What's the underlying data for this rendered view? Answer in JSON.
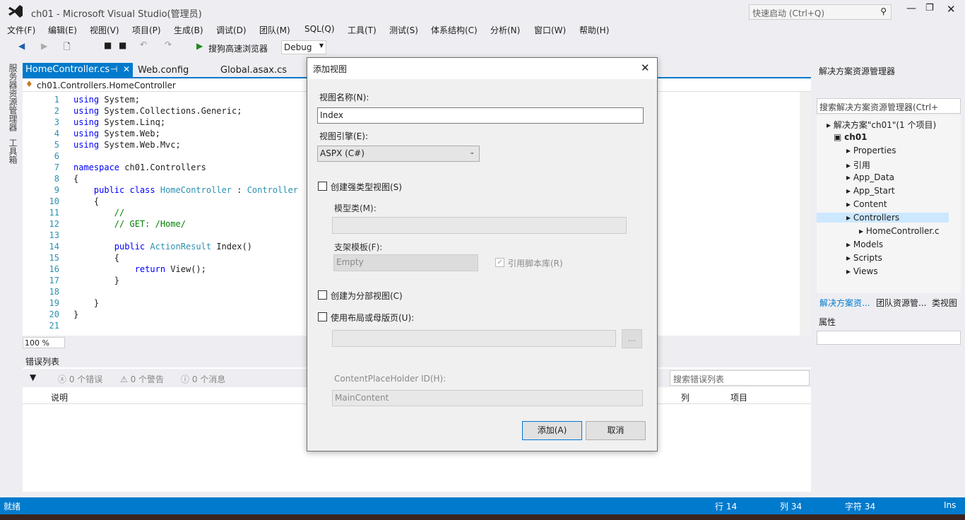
{
  "window": {
    "title": "ch01 - Microsoft Visual Studio(管理员)",
    "quick_launch": "快速启动 (Ctrl+Q)"
  },
  "menu": [
    "文件(F)",
    "编辑(E)",
    "视图(V)",
    "项目(P)",
    "生成(B)",
    "调试(D)",
    "团队(M)",
    "SQL(Q)",
    "工具(T)",
    "测试(S)",
    "体系结构(C)",
    "分析(N)",
    "窗口(W)",
    "帮助(H)"
  ],
  "toolbar": {
    "run_label": "搜狗高速浏览器",
    "config": "Debug"
  },
  "side_tabs": [
    "服务器资源管理器",
    "工具箱"
  ],
  "tabs": [
    "HomeController.cs",
    "Web.config",
    "Global.asax.cs"
  ],
  "nav_bar": "ch01.Controllers.HomeController",
  "code_lines": [
    [
      [
        "kw",
        "using"
      ],
      [
        "",
        "System;"
      ]
    ],
    [
      [
        "kw",
        "using"
      ],
      [
        "",
        "System.Collections.Generic;"
      ]
    ],
    [
      [
        "kw",
        "using"
      ],
      [
        "",
        "System.Linq;"
      ]
    ],
    [
      [
        "kw",
        "using"
      ],
      [
        "",
        "System.Web;"
      ]
    ],
    [
      [
        "kw",
        "using"
      ],
      [
        "",
        "System.Web.Mvc;"
      ]
    ],
    [],
    [
      [
        "kw",
        "namespace"
      ],
      [
        "",
        "ch01.Controllers"
      ]
    ],
    [
      [
        "",
        "{"
      ]
    ],
    [
      [
        "",
        "    "
      ],
      [
        "kw",
        "public class"
      ],
      [
        "ty",
        "HomeController"
      ],
      [
        "",
        ":"
      ],
      [
        "ty",
        "Controller"
      ]
    ],
    [
      [
        "",
        "    {"
      ]
    ],
    [
      [
        "cm",
        "        //"
      ]
    ],
    [
      [
        "cm",
        "        // GET: /Home/"
      ]
    ],
    [],
    [
      [
        "",
        "        "
      ],
      [
        "kw",
        "public"
      ],
      [
        "ty",
        "ActionResult"
      ],
      [
        "",
        "Index()"
      ]
    ],
    [
      [
        "",
        "        {"
      ]
    ],
    [
      [
        "",
        "            "
      ],
      [
        "kw",
        "return"
      ],
      [
        "",
        "View();"
      ]
    ],
    [
      [
        "",
        "        }"
      ]
    ],
    [],
    [
      [
        "",
        "    }"
      ]
    ],
    [
      [
        "",
        "}"
      ]
    ],
    []
  ],
  "zoom": "100 %",
  "error_list": {
    "title": "错误列表",
    "errors": "0 个错误",
    "warnings": "0 个警告",
    "messages": "0 个消息",
    "search_placeholder": "搜索错误列表",
    "columns": [
      "说明",
      "列",
      "项目"
    ]
  },
  "solution_explorer": {
    "title": "解决方案资源管理器",
    "search_placeholder": "搜索解决方案资源管理器(Ctrl+",
    "items": [
      "解决方案\"ch01\"(1 个项目)",
      "ch01",
      "Properties",
      "引用",
      "App_Data",
      "App_Start",
      "Content",
      "Controllers",
      "HomeController.c",
      "Models",
      "Scripts",
      "Views"
    ],
    "bottom_tabs": [
      "解决方案资...",
      "团队资源管...",
      "类视图"
    ]
  },
  "properties": {
    "title": "属性"
  },
  "dialog": {
    "title": "添加视图",
    "name_label": "视图名称(N):",
    "name_value": "Index",
    "engine_label": "视图引擎(E):",
    "engine_value": "ASPX (C#)",
    "strong_label": "创建强类型视图(S)",
    "model_label": "模型类(M):",
    "scaffold_label": "支架模板(F):",
    "scaffold_value": "Empty",
    "script_label": "引用脚本库(R)",
    "partial_label": "创建为分部视图(C)",
    "layout_label": "使用布局或母版页(U):",
    "browse": "...",
    "cph_label": "ContentPlaceHolder ID(H):",
    "cph_value": "MainContent",
    "add": "添加(A)",
    "cancel": "取消"
  },
  "status": {
    "ready": "就绪",
    "line": "行 14",
    "col": "列 34",
    "char": "字符 34",
    "mode": "Ins"
  },
  "colors": {
    "accent": "#007acc"
  }
}
